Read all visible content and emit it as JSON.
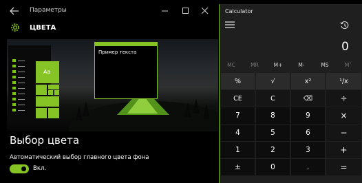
{
  "settings": {
    "window_title": "Параметры",
    "page_title": "ЦВЕТА",
    "preview": {
      "sample_text": "Пример текста",
      "tile_label": "Aa"
    },
    "choose_color_heading": "Выбор цвета",
    "auto_color_label": "Автоматический выбор главного цвета фона",
    "toggle": {
      "state_label": "Вкл.",
      "on": true
    },
    "accent_color": "#86c325"
  },
  "calculator": {
    "title": "Calculator",
    "display": "0",
    "memory_buttons": [
      {
        "label": "MC",
        "enabled": false
      },
      {
        "label": "MR",
        "enabled": false
      },
      {
        "label": "M+",
        "enabled": true
      },
      {
        "label": "M-",
        "enabled": true
      },
      {
        "label": "MS",
        "enabled": true
      },
      {
        "label": "M˅",
        "enabled": false
      }
    ],
    "rows": [
      [
        "%",
        "√",
        "x²",
        "¹/x"
      ],
      [
        "CE",
        "C",
        "⌫",
        "÷"
      ],
      [
        "7",
        "8",
        "9",
        "×"
      ],
      [
        "4",
        "5",
        "6",
        "−"
      ],
      [
        "1",
        "2",
        "3",
        "+"
      ],
      [
        "±",
        "0",
        ".",
        "="
      ]
    ]
  }
}
